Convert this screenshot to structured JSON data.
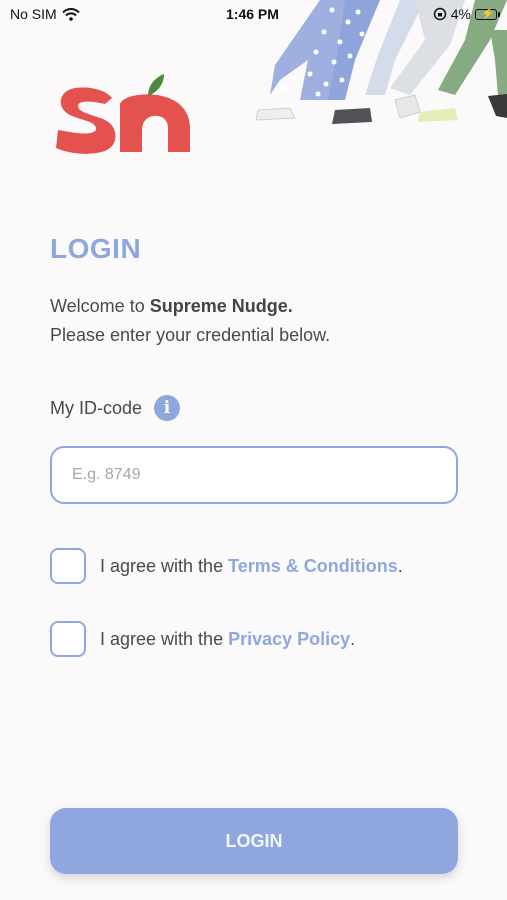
{
  "status_bar": {
    "carrier": "No SIM",
    "time": "1:46 PM",
    "battery": "4%"
  },
  "login": {
    "title": "LOGIN",
    "welcome_prefix": "Welcome to ",
    "app_name": "Supreme Nudge.",
    "subtitle": "Please enter your credential below."
  },
  "id_field": {
    "label": "My ID-code",
    "placeholder": "E.g. 8749",
    "value": ""
  },
  "terms": {
    "prefix": "I agree with the ",
    "link": "Terms & Conditions",
    "suffix": "."
  },
  "privacy": {
    "prefix": "I agree with the ",
    "link": "Privacy Policy",
    "suffix": "."
  },
  "button": {
    "label": "LOGIN"
  },
  "icons": {
    "info": "info-icon",
    "logo": "supreme-nudge-logo",
    "wifi": "wifi-icon",
    "battery": "battery-icon"
  },
  "colors": {
    "accent": "#8ea8df",
    "logo_red": "#e3524e",
    "leaf_green": "#4a8a3a",
    "background": "#fbf9f9"
  }
}
